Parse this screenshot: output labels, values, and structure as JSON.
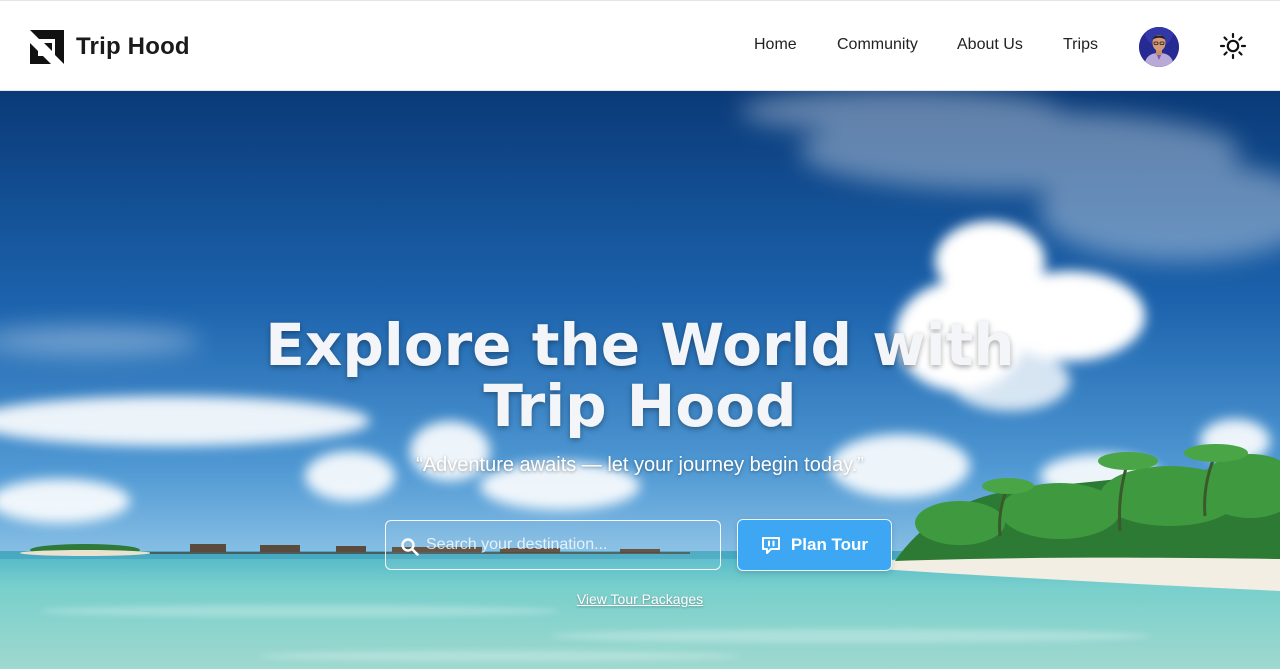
{
  "brand": {
    "name": "Trip Hood",
    "logo_icon": "brand-logo-icon"
  },
  "nav": {
    "items": [
      {
        "label": "Home"
      },
      {
        "label": "Community"
      },
      {
        "label": "About Us"
      },
      {
        "label": "Trips"
      }
    ],
    "avatar_icon": "user-avatar",
    "theme_icon": "sun-icon"
  },
  "hero": {
    "title": "Explore the World with Trip Hood",
    "subtitle": "“Adventure awaits — let your journey begin today.”",
    "search": {
      "placeholder": "Search your destination...",
      "value": "",
      "icon": "search-icon"
    },
    "plan_button": {
      "label": "Plan Tour",
      "icon": "chat-bubble-icon"
    },
    "packages_link": "View Tour Packages"
  },
  "colors": {
    "accent": "#3ea7f4",
    "header_bg": "#ffffff",
    "text_dark": "#1a1a1a",
    "sky_top": "#0c3d7a",
    "sea": "#7fd2cf"
  }
}
